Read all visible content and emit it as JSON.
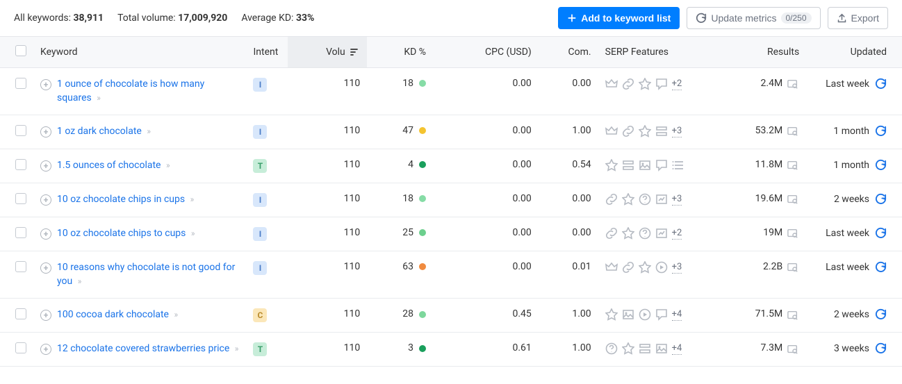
{
  "summary": {
    "all_keywords_label": "All keywords:",
    "all_keywords_value": "38,911",
    "total_volume_label": "Total volume:",
    "total_volume_value": "17,009,920",
    "avg_kd_label": "Average KD:",
    "avg_kd_value": "33%"
  },
  "actions": {
    "add_to_list": "Add to keyword list",
    "update_metrics": "Update metrics",
    "update_badge": "0/250",
    "export": "Export"
  },
  "columns": {
    "keyword": "Keyword",
    "intent": "Intent",
    "volume": "Volu",
    "kd": "KD %",
    "cpc": "CPC (USD)",
    "com": "Com.",
    "serp": "SERP Features",
    "results": "Results",
    "updated": "Updated"
  },
  "rows": [
    {
      "keyword": "1 ounce of chocolate is how many squares",
      "intent": "I",
      "volume": "110",
      "kd": "18",
      "kd_color": "#86dca6",
      "cpc": "0.00",
      "com": "0.00",
      "serp_icons": [
        "crown",
        "link",
        "star",
        "comment"
      ],
      "serp_more": "+2",
      "results": "2.4M",
      "updated": "Last week"
    },
    {
      "keyword": "1 oz dark chocolate",
      "intent": "I",
      "volume": "110",
      "kd": "47",
      "kd_color": "#f4c430",
      "cpc": "0.00",
      "com": "1.00",
      "serp_icons": [
        "crown",
        "link",
        "star",
        "layout"
      ],
      "serp_more": "+3",
      "results": "53.2M",
      "updated": "1 month"
    },
    {
      "keyword": "1.5 ounces of chocolate",
      "intent": "T",
      "volume": "110",
      "kd": "4",
      "kd_color": "#1a9f5c",
      "cpc": "0.00",
      "com": "0.54",
      "serp_icons": [
        "star",
        "layout",
        "image",
        "comment",
        "list"
      ],
      "serp_more": "",
      "results": "11.8M",
      "updated": "1 month"
    },
    {
      "keyword": "10 oz chocolate chips in cups",
      "intent": "I",
      "volume": "110",
      "kd": "18",
      "kd_color": "#86dca6",
      "cpc": "0.00",
      "com": "0.00",
      "serp_icons": [
        "link",
        "star",
        "question",
        "chart"
      ],
      "serp_more": "+3",
      "results": "19.6M",
      "updated": "2 weeks"
    },
    {
      "keyword": "10 oz chocolate chips to cups",
      "intent": "I",
      "volume": "110",
      "kd": "25",
      "kd_color": "#6ccf8d",
      "cpc": "0.00",
      "com": "0.00",
      "serp_icons": [
        "link",
        "star",
        "question",
        "chart"
      ],
      "serp_more": "+2",
      "results": "19M",
      "updated": "Last week"
    },
    {
      "keyword": "10 reasons why chocolate is not good for you",
      "intent": "I",
      "volume": "110",
      "kd": "63",
      "kd_color": "#f08b3f",
      "cpc": "0.00",
      "com": "0.01",
      "serp_icons": [
        "crown",
        "link",
        "star",
        "play"
      ],
      "serp_more": "+3",
      "results": "2.2B",
      "updated": "Last week"
    },
    {
      "keyword": "100 cocoa dark chocolate",
      "intent": "C",
      "volume": "110",
      "kd": "28",
      "kd_color": "#7dd79c",
      "cpc": "0.45",
      "com": "1.00",
      "serp_icons": [
        "star",
        "image",
        "play",
        "comment"
      ],
      "serp_more": "+4",
      "results": "71.5M",
      "updated": "2 weeks"
    },
    {
      "keyword": "12 chocolate covered strawberries price",
      "intent": "T",
      "volume": "110",
      "kd": "3",
      "kd_color": "#1a9f5c",
      "cpc": "0.61",
      "com": "1.00",
      "serp_icons": [
        "question",
        "star",
        "layout",
        "image"
      ],
      "serp_more": "+4",
      "results": "7.3M",
      "updated": "3 weeks"
    }
  ]
}
